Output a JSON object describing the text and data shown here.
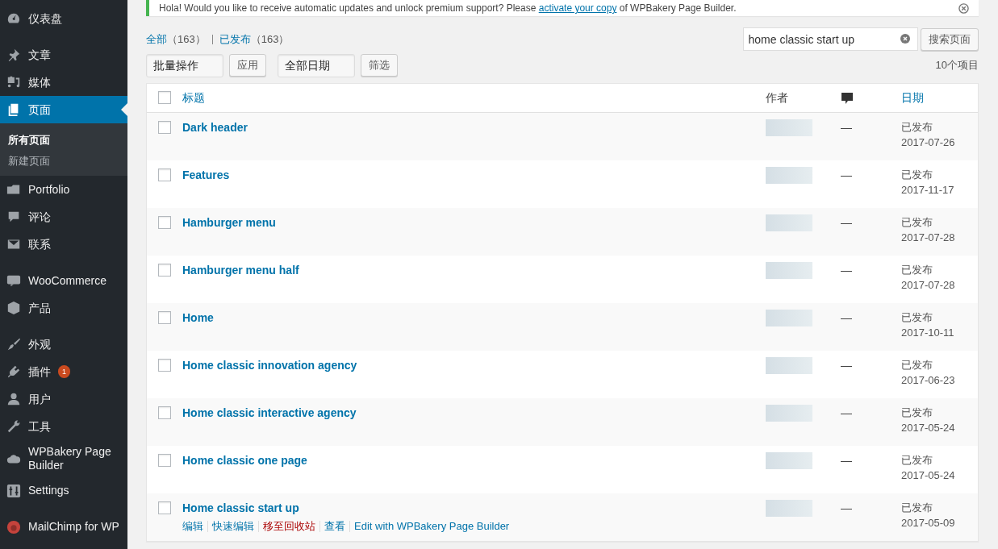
{
  "sidebar": {
    "groups": [
      [
        {
          "label": "仪表盘",
          "current": false
        }
      ],
      [
        {
          "label": "文章",
          "current": false
        },
        {
          "label": "媒体",
          "current": false
        },
        {
          "label": "页面",
          "current": true,
          "submenu": [
            {
              "label": "所有页面",
              "selected": true
            },
            {
              "label": "新建页面",
              "selected": false
            }
          ]
        },
        {
          "label": "Portfolio",
          "current": false
        },
        {
          "label": "评论",
          "current": false
        },
        {
          "label": "联系",
          "current": false
        }
      ],
      [
        {
          "label": "WooCommerce",
          "current": false
        },
        {
          "label": "产品",
          "current": false
        }
      ],
      [
        {
          "label": "外观",
          "current": false
        },
        {
          "label": "插件",
          "current": false,
          "badge": "1"
        },
        {
          "label": "用户",
          "current": false
        },
        {
          "label": "工具",
          "current": false
        },
        {
          "label": "WPBakery Page Builder",
          "current": false
        },
        {
          "label": "Settings",
          "current": false
        }
      ],
      [
        {
          "label": "MailChimp for WP",
          "current": false
        }
      ]
    ]
  },
  "notice": {
    "text": "Hola! Would you like to receive automatic updates and unlock premium support? Please ",
    "link": "activate your copy",
    "after": " of WPBakery Page Builder."
  },
  "status_links": [
    {
      "label": "全部",
      "count": "（163）"
    },
    {
      "label": "已发布",
      "count": "（163）"
    }
  ],
  "search": {
    "value": "home classic start up",
    "button": "搜索页面"
  },
  "bulk_action": {
    "value": "批量操作",
    "button": "应用"
  },
  "date_filter": {
    "value": "全部日期",
    "button": "筛选"
  },
  "item_count": "10个项目",
  "table": {
    "select_all_checked": false,
    "columns": {
      "title": "标题",
      "author": "作者",
      "date": "日期"
    },
    "rows": [
      {
        "title": "Dark header",
        "checked": false,
        "comments": "—",
        "status": "已发布",
        "date": "2017-07-26"
      },
      {
        "title": "Features",
        "checked": false,
        "comments": "—",
        "status": "已发布",
        "date": "2017-11-17"
      },
      {
        "title": "Hamburger menu",
        "checked": false,
        "comments": "—",
        "status": "已发布",
        "date": "2017-07-28"
      },
      {
        "title": "Hamburger menu half",
        "checked": false,
        "comments": "—",
        "status": "已发布",
        "date": "2017-07-28"
      },
      {
        "title": "Home",
        "checked": false,
        "comments": "—",
        "status": "已发布",
        "date": "2017-10-11"
      },
      {
        "title": "Home classic innovation agency",
        "checked": false,
        "comments": "—",
        "status": "已发布",
        "date": "2017-06-23"
      },
      {
        "title": "Home classic interactive agency",
        "checked": false,
        "comments": "—",
        "status": "已发布",
        "date": "2017-05-24"
      },
      {
        "title": "Home classic one page",
        "checked": false,
        "comments": "—",
        "status": "已发布",
        "date": "2017-05-24"
      },
      {
        "title": "Home classic start up",
        "checked": false,
        "comments": "—",
        "status": "已发布",
        "date": "2017-05-09",
        "actions": [
          {
            "label": "编辑",
            "kind": "link"
          },
          {
            "label": "快速编辑",
            "kind": "link"
          },
          {
            "label": "移至回收站",
            "kind": "delete"
          },
          {
            "label": "查看",
            "kind": "link"
          },
          {
            "label": "Edit with WPBakery Page Builder",
            "kind": "link"
          }
        ]
      }
    ]
  }
}
